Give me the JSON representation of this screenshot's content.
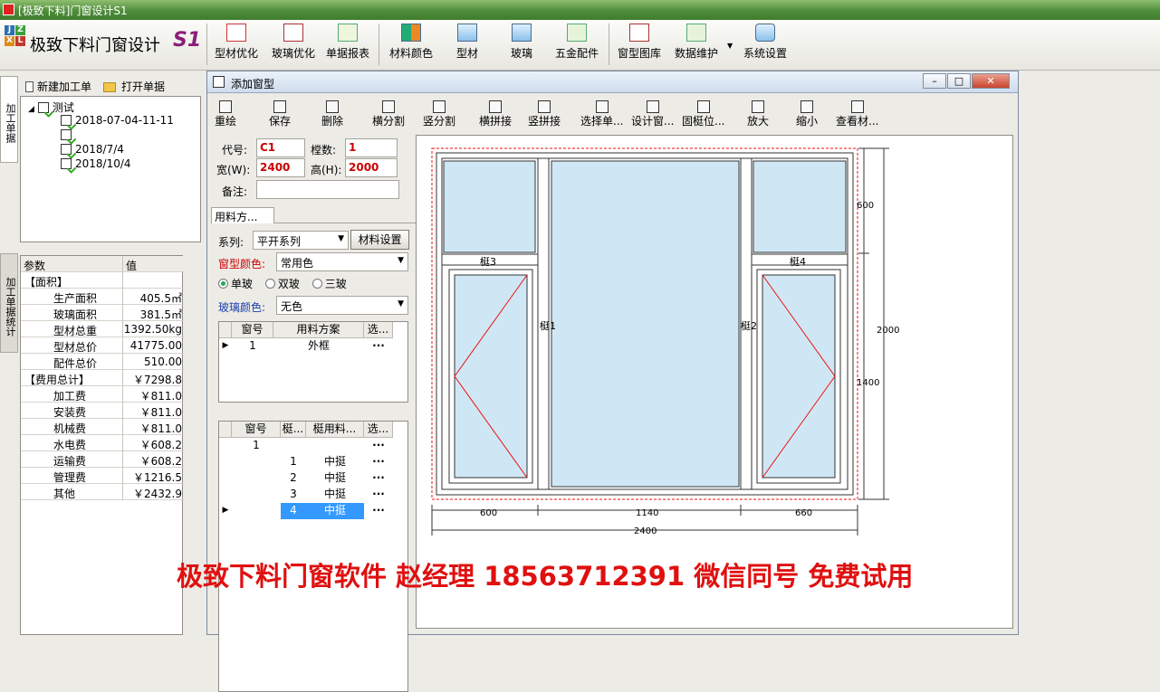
{
  "app": {
    "title": "[极致下料]门窗设计S1"
  },
  "logo": {
    "letters": [
      "J",
      "Z",
      "X",
      "L"
    ],
    "text": "极致下料门窗设计",
    "suffix": "S1"
  },
  "toolbar": {
    "items": [
      "型材优化",
      "玻璃优化",
      "单据报表",
      "材料颜色",
      "型材",
      "玻璃",
      "五金配件",
      "窗型图库",
      "数据维护",
      "系统设置"
    ]
  },
  "left_tabs": {
    "tab1": "加工单据",
    "tab2": "加工单据统计"
  },
  "left_panel": {
    "new_order": "新建加工单",
    "open_order": "打开单据",
    "tree": {
      "root": "测试",
      "children": [
        "2018-07-04-11-11",
        "",
        "2018/7/4",
        "2018/10/4"
      ]
    }
  },
  "stats": {
    "headers": [
      "参数",
      "值"
    ],
    "rows": [
      {
        "k": "【面积】",
        "v": "",
        "lvl": 0
      },
      {
        "k": "生产面积",
        "v": "405.5㎡",
        "lvl": 1
      },
      {
        "k": "玻璃面积",
        "v": "381.5㎡",
        "lvl": 1
      },
      {
        "k": "型材总重",
        "v": "1392.50kg",
        "lvl": 1
      },
      {
        "k": "型材总价",
        "v": "41775.00",
        "lvl": 1
      },
      {
        "k": "配件总价",
        "v": "510.00",
        "lvl": 1
      },
      {
        "k": "【费用总计】",
        "v": "￥7298.8",
        "lvl": 0
      },
      {
        "k": "加工费",
        "v": "￥811.0",
        "lvl": 1
      },
      {
        "k": "安装费",
        "v": "￥811.0",
        "lvl": 1
      },
      {
        "k": "机械费",
        "v": "￥811.0",
        "lvl": 1
      },
      {
        "k": "水电费",
        "v": "￥608.2",
        "lvl": 1
      },
      {
        "k": "运输费",
        "v": "￥608.2",
        "lvl": 1
      },
      {
        "k": "管理费",
        "v": "￥1216.5",
        "lvl": 1
      },
      {
        "k": "其他",
        "v": "￥2432.9",
        "lvl": 1
      }
    ]
  },
  "dialog": {
    "title": "添加窗型",
    "win_buttons": [
      "–",
      "□",
      "✕"
    ],
    "tools": [
      "重绘",
      "保存",
      "删除",
      "横分割",
      "竖分割",
      "横拼接",
      "竖拼接",
      "选择单...",
      "设计窗...",
      "固梃位...",
      "放大",
      "缩小",
      "查看材..."
    ],
    "form": {
      "code_label": "代号:",
      "code": "C1",
      "count_label": "樘数:",
      "count": "1",
      "width_label": "宽(W):",
      "width": "2400",
      "height_label": "高(H):",
      "height": "2000",
      "note_label": "备注:",
      "note": "",
      "tab": "用料方...",
      "series_label": "系列:",
      "series": "平开系列",
      "material_btn": "材料设置",
      "color_label": "窗型颜色:",
      "color": "常用色",
      "glass_options": [
        "单玻",
        "双玻",
        "三玻"
      ],
      "glass_color_label": "玻璃颜色:",
      "glass_color": "无色"
    },
    "grid1": {
      "headers": [
        "窗号",
        "用料方案",
        "选..."
      ],
      "rows": [
        [
          "1",
          "外框",
          "···"
        ]
      ]
    },
    "grid2": {
      "headers": [
        "窗号",
        "梃...",
        "梃用料...",
        "选..."
      ],
      "rows": [
        [
          "1",
          "",
          "",
          "···"
        ],
        [
          "",
          "1",
          "中挺",
          "···"
        ],
        [
          "",
          "2",
          "中挺",
          "···"
        ],
        [
          "",
          "3",
          "中挺",
          "···"
        ],
        [
          "",
          "4",
          "中挺",
          "···"
        ]
      ]
    }
  },
  "drawing": {
    "labels": {
      "m1": "梃1",
      "m2": "梃2",
      "m3": "梃3",
      "m4": "梃4"
    },
    "dims": {
      "top": "600",
      "bottom": "1400",
      "total_h": "2000",
      "w_left": "600",
      "w_mid": "1140",
      "w_right": "660",
      "total_w": "2400"
    }
  },
  "watermark": "极致下料门窗软件 赵经理 18563712391 微信同号 免费试用",
  "colors": {
    "glass": "#cfe7f5",
    "accent": "#e01010",
    "titlebar": "#4f8d3b"
  }
}
